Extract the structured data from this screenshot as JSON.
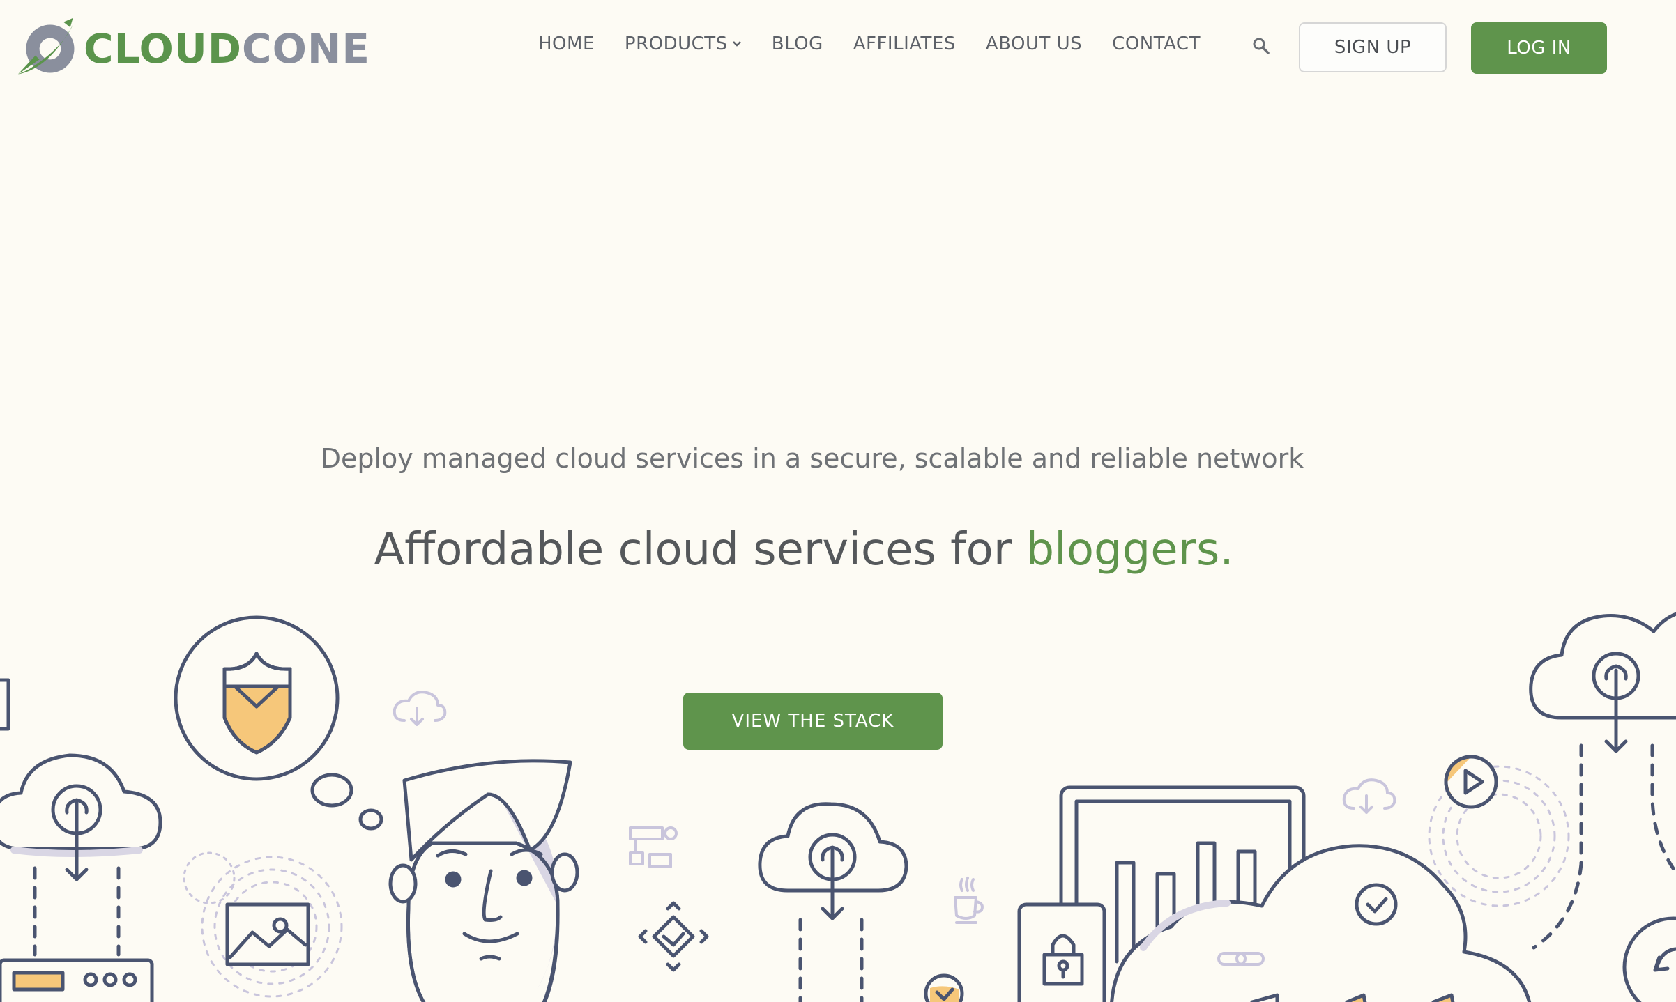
{
  "brand": {
    "name_part1": "CLOUD",
    "name_part2": "CONE",
    "primary_color": "#5f944c",
    "secondary_color": "#8a8f9d",
    "background_color": "#fdfbf4",
    "illustration_accent": "#f6c77a",
    "illustration_stroke": "#4a5470"
  },
  "nav": {
    "items": [
      {
        "label": "HOME"
      },
      {
        "label": "PRODUCTS",
        "has_dropdown": true
      },
      {
        "label": "BLOG"
      },
      {
        "label": "AFFILIATES"
      },
      {
        "label": "ABOUT US"
      },
      {
        "label": "CONTACT"
      }
    ],
    "search_icon": "search-icon",
    "dropdown_icon": "chevron-down-icon"
  },
  "auth": {
    "signup_label": "SIGN UP",
    "login_label": "LOG IN"
  },
  "hero": {
    "subtitle": "Deploy managed cloud services in a secure, scalable and reliable network",
    "title_prefix": "Affordable cloud services for ",
    "title_accent": "bloggers.",
    "cta_label": "VIEW THE STACK"
  },
  "illustration": {
    "icons": [
      "shield-icon",
      "cloud-upload-icon",
      "image-icon",
      "person-illustration",
      "diamond-check-icon",
      "coffee-cup-icon",
      "flowchart-icon",
      "tablet-chart-icon",
      "padlock-icon",
      "cloud-check-icon",
      "chain-link-icon",
      "play-icon",
      "server-icon"
    ]
  }
}
